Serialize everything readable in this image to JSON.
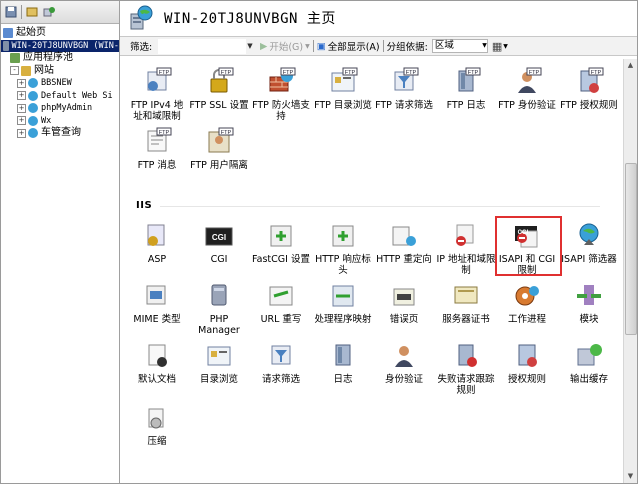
{
  "tree": {
    "items": [
      {
        "label": "起始页",
        "indent": 0,
        "expand": "",
        "icon": "start-page-icon",
        "selected": false,
        "mono": false
      },
      {
        "label": "WIN-20TJ8UNVBGN (WIN-",
        "indent": 0,
        "expand": "",
        "icon": "server-icon",
        "selected": true,
        "mono": true
      },
      {
        "label": "应用程序池",
        "indent": 1,
        "expand": "",
        "icon": "app-pool-icon",
        "selected": false,
        "mono": false
      },
      {
        "label": "网站",
        "indent": 1,
        "expand": "-",
        "icon": "sites-folder-icon",
        "selected": false,
        "mono": false
      },
      {
        "label": "BBSNEW",
        "indent": 2,
        "expand": "+",
        "icon": "website-icon",
        "selected": false,
        "mono": true
      },
      {
        "label": "Default Web Si",
        "indent": 2,
        "expand": "+",
        "icon": "website-icon",
        "selected": false,
        "mono": true
      },
      {
        "label": "phpMyAdmin",
        "indent": 2,
        "expand": "+",
        "icon": "website-icon",
        "selected": false,
        "mono": true
      },
      {
        "label": "Wx",
        "indent": 2,
        "expand": "+",
        "icon": "website-icon",
        "selected": false,
        "mono": true
      },
      {
        "label": "车管查询",
        "indent": 2,
        "expand": "+",
        "icon": "website-icon",
        "selected": false,
        "mono": false
      }
    ]
  },
  "header": {
    "title": "WIN-20TJ8UNVBGN 主页"
  },
  "filter": {
    "label": "筛选:",
    "start": "开始(G)",
    "showall": "全部显示(A)",
    "groupby": "分组依据:",
    "groupvalue": "区域"
  },
  "sections": {
    "iis": "IIS"
  },
  "ftp_tiles": [
    {
      "label": "FTP IPv4 地址和域限制",
      "icon": "ftp-ipv4-icon"
    },
    {
      "label": "FTP SSL 设置",
      "icon": "ftp-ssl-lock-icon"
    },
    {
      "label": "FTP 防火墙支持",
      "icon": "ftp-firewall-icon"
    },
    {
      "label": "FTP 目录浏览",
      "icon": "ftp-directory-browse-icon"
    },
    {
      "label": "FTP 请求筛选",
      "icon": "ftp-request-filter-icon"
    },
    {
      "label": "FTP 日志",
      "icon": "ftp-log-icon"
    },
    {
      "label": "FTP 身份验证",
      "icon": "ftp-auth-icon"
    },
    {
      "label": "FTP 授权规则",
      "icon": "ftp-authz-icon"
    },
    {
      "label": "FTP 消息",
      "icon": "ftp-message-icon"
    },
    {
      "label": "FTP 用户隔离",
      "icon": "ftp-user-isolation-icon"
    }
  ],
  "iis_tiles": [
    {
      "label": "ASP",
      "icon": "asp-icon"
    },
    {
      "label": "CGI",
      "icon": "cgi-icon"
    },
    {
      "label": "FastCGI 设置",
      "icon": "fastcgi-icon"
    },
    {
      "label": "HTTP 响应标头",
      "icon": "http-headers-icon"
    },
    {
      "label": "HTTP 重定向",
      "icon": "http-redirect-icon"
    },
    {
      "label": "IP 地址和域限制",
      "icon": "ip-restrictions-icon"
    },
    {
      "label": "ISAPI 和 CGI 限制",
      "icon": "isapi-cgi-restrictions-icon"
    },
    {
      "label": "ISAPI 筛选器",
      "icon": "isapi-filters-icon"
    },
    {
      "label": "MIME 类型",
      "icon": "mime-types-icon"
    },
    {
      "label": "PHP Manager",
      "icon": "php-manager-icon"
    },
    {
      "label": "URL 重写",
      "icon": "url-rewrite-icon"
    },
    {
      "label": "处理程序映射",
      "icon": "handler-mappings-icon"
    },
    {
      "label": "错误页",
      "icon": "error-pages-icon"
    },
    {
      "label": "服务器证书",
      "icon": "server-certificates-icon"
    },
    {
      "label": "工作进程",
      "icon": "worker-processes-icon"
    },
    {
      "label": "模块",
      "icon": "modules-icon"
    },
    {
      "label": "默认文档",
      "icon": "default-document-icon"
    },
    {
      "label": "目录浏览",
      "icon": "directory-browsing-icon"
    },
    {
      "label": "请求筛选",
      "icon": "request-filtering-icon"
    },
    {
      "label": "日志",
      "icon": "logging-icon"
    },
    {
      "label": "身份验证",
      "icon": "authentication-icon"
    },
    {
      "label": "失败请求跟踪规则",
      "icon": "failed-request-tracing-icon"
    },
    {
      "label": "授权规则",
      "icon": "authorization-rules-icon"
    },
    {
      "label": "输出缓存",
      "icon": "output-caching-icon"
    },
    {
      "label": "压缩",
      "icon": "compression-icon"
    }
  ],
  "highlighted_tile": "ISAPI 和 CGI 限制"
}
